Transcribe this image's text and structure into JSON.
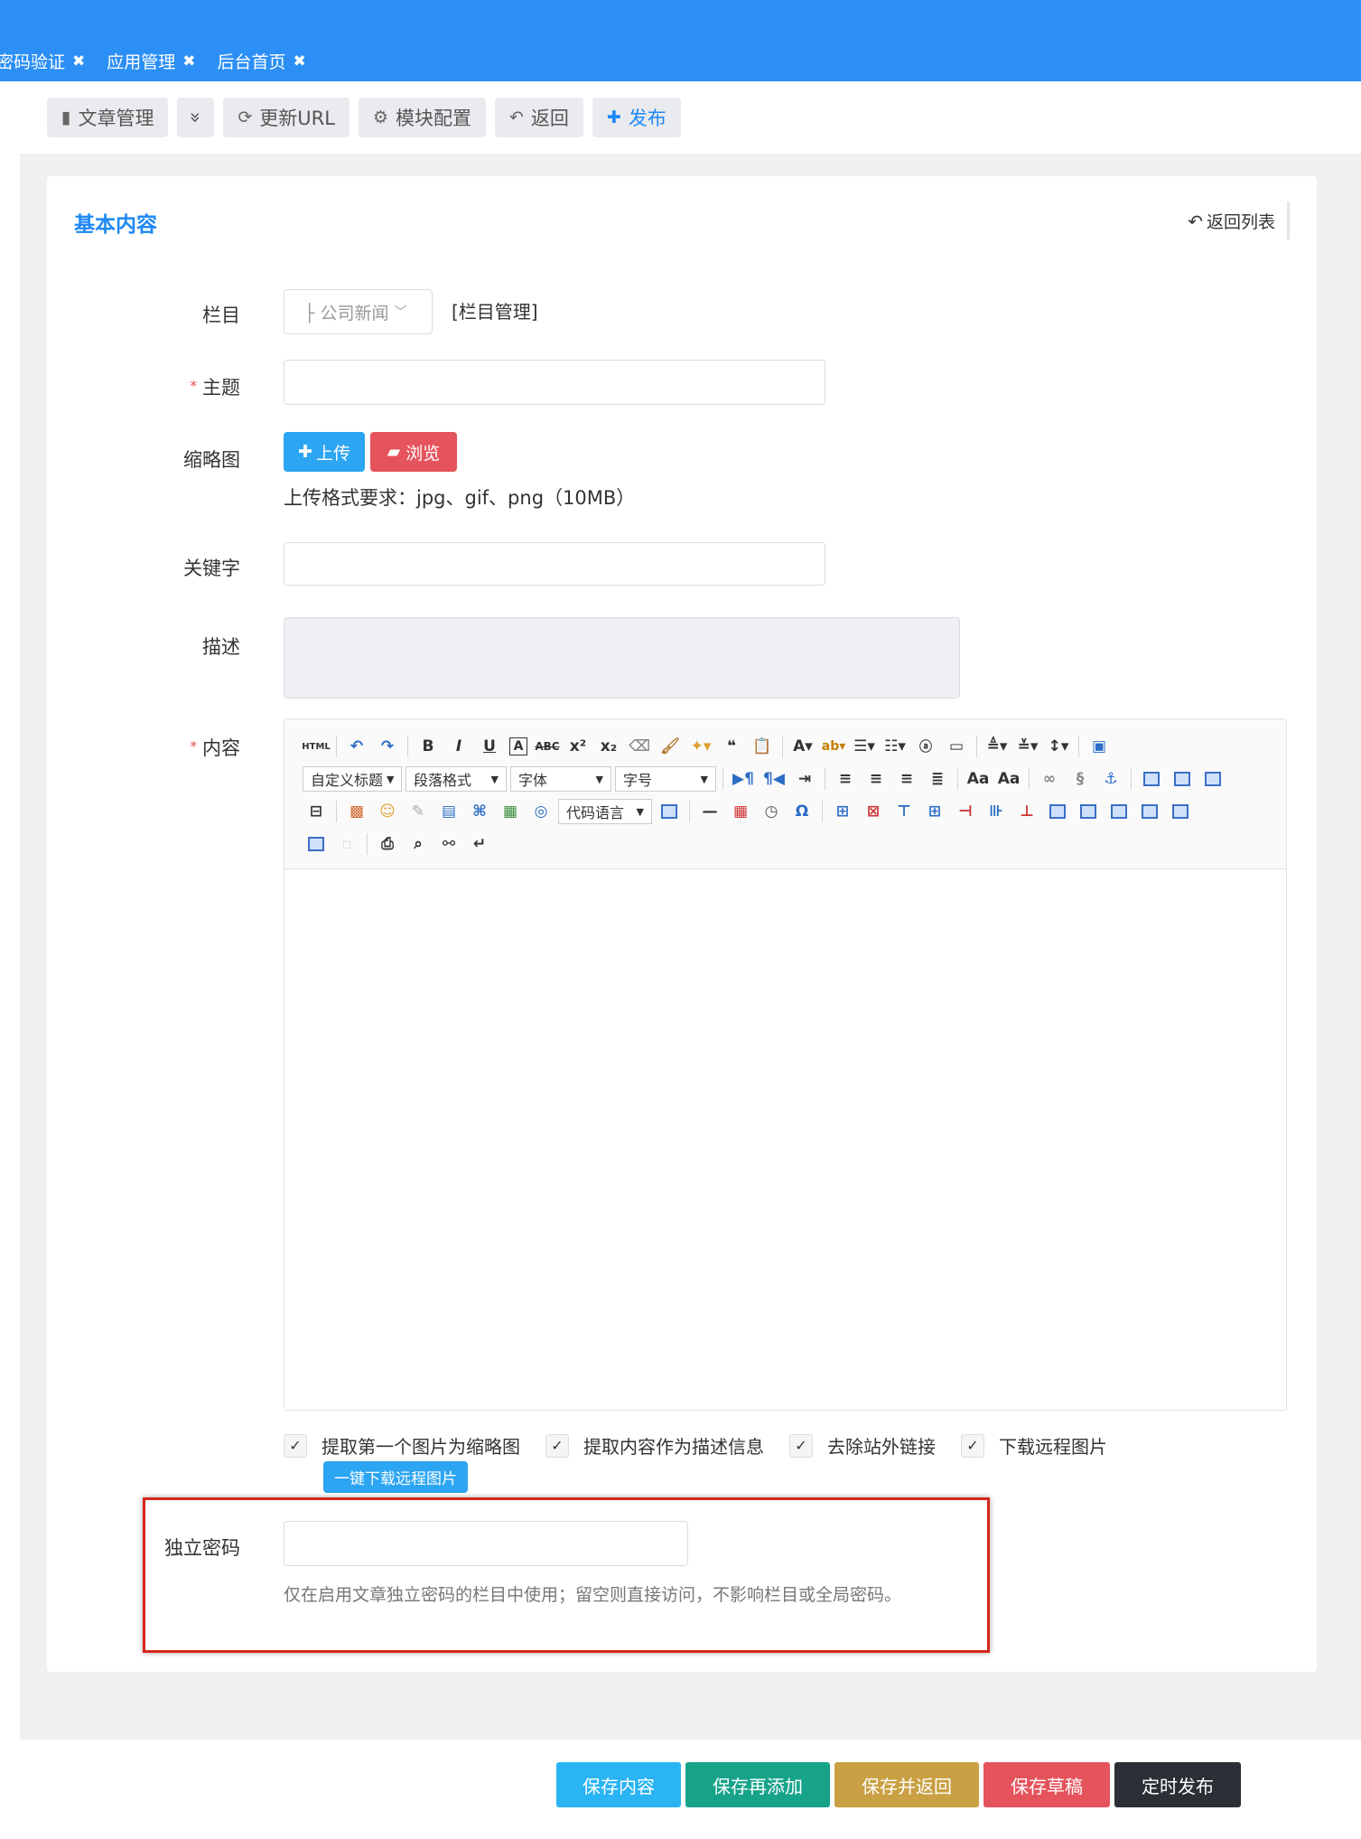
{
  "tabs": [
    {
      "label": "密码验证",
      "close": "✖"
    },
    {
      "label": "应用管理",
      "close": "✖"
    },
    {
      "label": "后台首页",
      "close": "✖"
    }
  ],
  "toolbar": {
    "article_manage": "文章管理",
    "more": "»",
    "update_url": "更新URL",
    "module_config": "模块配置",
    "back": "返回",
    "publish": "发布"
  },
  "card": {
    "title": "基本内容",
    "back_to_list": "返回列表"
  },
  "form": {
    "category_label": "栏目",
    "category_value": "├ 公司新闻",
    "category_manage": "[栏目管理]",
    "subject_label": "主题",
    "required_mark": "*",
    "thumb_label": "缩略图",
    "upload_btn": "上传",
    "browse_btn": "浏览",
    "upload_hint": "上传格式要求：jpg、gif、png（10MB）",
    "keywords_label": "关键字",
    "description_label": "描述",
    "content_label": "内容",
    "editor_selects": {
      "heading": "自定义标题",
      "paragraph": "段落格式",
      "font": "字体",
      "size": "字号",
      "code_lang": "代码语言"
    },
    "checks": [
      "提取第一个图片为缩略图",
      "提取内容作为描述信息",
      "去除站外链接",
      "下载远程图片"
    ],
    "download_btn": "一键下载远程图片",
    "password_label": "独立密码",
    "password_hint": "仅在启用文章独立密码的栏目中使用；留空则直接访问，不影响栏目或全局密码。"
  },
  "actions": {
    "save": "保存内容",
    "save_add": "保存再添加",
    "save_return": "保存并返回",
    "save_draft": "保存草稿",
    "schedule": "定时发布"
  },
  "colors": {
    "topbar": "#2c8ff5",
    "accent": "#1e88f5",
    "save": "#2ab4f3",
    "save_add": "#17a38a",
    "save_return": "#c9a043",
    "save_draft": "#e5535c",
    "schedule": "#2b3036",
    "highlight": "#d9251d"
  }
}
